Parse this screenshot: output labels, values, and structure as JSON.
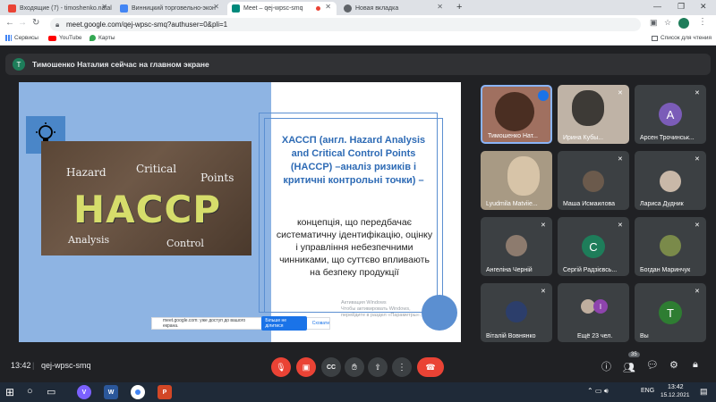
{
  "browser": {
    "tabs": [
      {
        "label": "Входящие (7) - timoshenko.natal",
        "icon": "gmail-icon"
      },
      {
        "label": "Винницкий торговельно-экон",
        "icon": "doc-icon"
      },
      {
        "label": "Meet – qej-wpsc-smq",
        "icon": "meet-icon"
      },
      {
        "label": "Новая вкладка",
        "icon": "chrome-icon"
      }
    ],
    "url": "meet.google.com/qej-wpsc-smq?authuser=0&pli=1",
    "bookmarks": {
      "apps": "Сервисы",
      "youtube": "YouTube",
      "maps": "Карты",
      "reading_list": "Список для чтения"
    }
  },
  "meet": {
    "banner": {
      "initial": "Т",
      "text": "Тимошенко Наталия сейчас на главном экране"
    },
    "slide": {
      "badge_words": {
        "hazard": "Hazard",
        "critical": "Critical",
        "points": "Points",
        "haccp": "HACCP",
        "analysis": "Analysis",
        "control": "Control"
      },
      "title": "ХАССП (англ. Hazard Analysis and Critical Control Points (HACCP) –аналіз ризиків і критичні контрольні точки) –",
      "body": "концепція, що передбачає систематичну ідентифікацію, оцінку і управління небезпечними чинниками, що суттєво впливають на безпеку продукції",
      "watermark": "Активация Windows\nЧтобы активировать Windows, перейдите в раздел «Параметры»."
    },
    "share_bar": {
      "text": "meet.google.com: уже доступ до вашого екрана.",
      "stop": "Більше не ділитися",
      "hide": "Сховати"
    },
    "participants": [
      {
        "name": "Тимошенко Нат...",
        "kind": "video",
        "speaking": true
      },
      {
        "name": "Ирина Кубы...",
        "kind": "video"
      },
      {
        "name": "Арсен Трочинськ...",
        "kind": "avatar",
        "initial": "А",
        "color": "#7b5cb8"
      },
      {
        "name": "Lyudmila Matviie...",
        "kind": "video"
      },
      {
        "name": "Маша Исмаилова",
        "kind": "photo"
      },
      {
        "name": "Лариса Дудник",
        "kind": "photo"
      },
      {
        "name": "Ангеліна Черній",
        "kind": "photo"
      },
      {
        "name": "Сергій Радзієвсь...",
        "kind": "avatar",
        "initial": "С",
        "color": "#1e7d5a"
      },
      {
        "name": "Богдан Маринчук",
        "kind": "photo"
      },
      {
        "name": "Віталій Вовнянко",
        "kind": "photo"
      },
      {
        "name": "Ещё 23 чел.",
        "kind": "more",
        "initial": "І",
        "color": "#8e44ad"
      },
      {
        "name": "Вы",
        "kind": "avatar",
        "initial": "Т",
        "color": "#2e7d32"
      }
    ],
    "bottom": {
      "time": "13:42",
      "code": "qej-wpsc-smq",
      "people_count": "35"
    }
  },
  "taskbar": {
    "lang": "ENG",
    "time": "13:42",
    "date": "15.12.2021"
  }
}
